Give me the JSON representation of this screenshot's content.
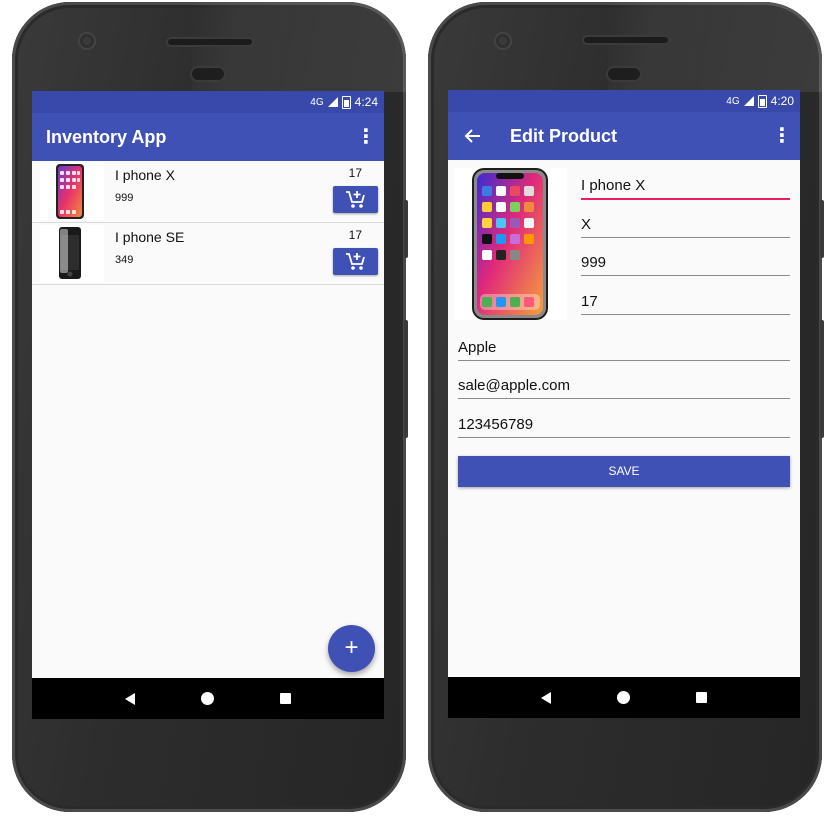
{
  "left": {
    "status": {
      "signal": "4G",
      "time": "4:24"
    },
    "appbar": {
      "title": "Inventory App",
      "menu_icon": "more-vert-icon"
    },
    "products": [
      {
        "name": "I phone X",
        "price": "999",
        "quantity": "17"
      },
      {
        "name": "I phone SE",
        "price": "349",
        "quantity": "17"
      }
    ],
    "fab_label": "+"
  },
  "right": {
    "status": {
      "signal": "4G",
      "time": "4:20"
    },
    "appbar": {
      "title": "Edit Product",
      "back_icon": "arrow-back-icon",
      "menu_icon": "more-vert-icon"
    },
    "form": {
      "name": "I phone X",
      "model": "X",
      "price": "999",
      "quantity": "17",
      "supplier": "Apple",
      "email": "sale@apple.com",
      "phone": "123456789"
    },
    "save_label": "SAVE"
  },
  "colors": {
    "primary": "#3f51b5",
    "status_bar": "#3949ab",
    "accent": "#e91e63"
  }
}
